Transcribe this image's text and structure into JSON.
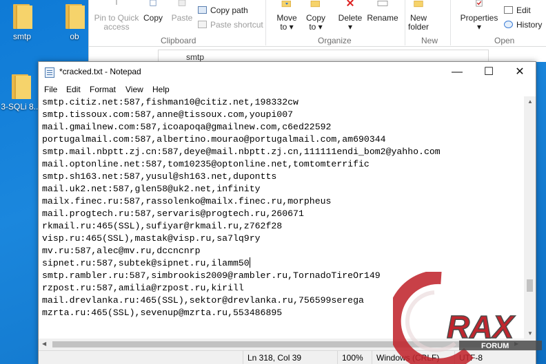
{
  "desktop": {
    "icons": [
      {
        "label": "smtp"
      },
      {
        "label": "ob"
      },
      {
        "label": "3-SQLi 8..."
      }
    ]
  },
  "explorer": {
    "ribbon": {
      "pin": "Pin to Quick\naccess",
      "copy": "Copy",
      "paste": "Paste",
      "copy_path": "Copy path",
      "paste_shortcut": "Paste shortcut",
      "clipboard": "Clipboard",
      "move_to": "Move\nto ▾",
      "copy_to": "Copy\nto ▾",
      "delete": "Delete\n▾",
      "rename": "Rename",
      "organize": "Organize",
      "new_folder": "New\nfolder",
      "new": "New",
      "properties": "Properties\n▾",
      "edit": "Edit",
      "history": "History",
      "open": "Open"
    },
    "address": "smtp"
  },
  "notepad": {
    "title": "*cracked.txt - Notepad",
    "window_buttons": {
      "minimize": "—",
      "maximize": "☐",
      "close": "✕"
    },
    "menu": [
      "File",
      "Edit",
      "Format",
      "View",
      "Help"
    ],
    "lines": [
      "smtp.citiz.net:587,fishman10@citiz.net,198332cw",
      "smtp.tissoux.com:587,anne@tissoux.com,youpi007",
      "mail.gmailnew.com:587,icoapoqa@gmailnew.com,c6ed22592",
      "portugalmail.com:587,albertino.mourao@portugalmail.com,am690344",
      "smtp.mail.nbptt.zj.cn:587,deye@mail.nbptt.zj.cn,111111endi_bom2@yahho.com",
      "mail.optonline.net:587,tom10235@optonline.net,tomtomterrific",
      "smtp.sh163.net:587,yusul@sh163.net,dupontts",
      "mail.uk2.net:587,glen58@uk2.net,infinity",
      "mailx.finec.ru:587,rassolenko@mailx.finec.ru,morpheus",
      "mail.progtech.ru:587,servaris@progtech.ru,260671",
      "rkmail.ru:465(SSL),sufiyar@rkmail.ru,z762f28",
      "visp.ru:465(SSL),mastak@visp.ru,sa7lq9ry",
      "mv.ru:587,alec@mv.ru,dccncnrp",
      "sipnet.ru:587,subtek@sipnet.ru,ilamm50",
      "smtp.rambler.ru:587,simbrookis2009@rambler.ru,TornadoTireOr149",
      "rzpost.ru:587,amilia@rzpost.ru,kirill",
      "mail.drevlanka.ru:465(SSL),sektor@drevlanka.ru,756599serega",
      "mzrta.ru:465(SSL),sevenup@mzrta.ru,553486895"
    ],
    "status": {
      "position": "Ln 318, Col 39",
      "zoom": "100%",
      "line_endings": "Windows (CRLF)",
      "encoding": "UTF-8"
    }
  },
  "watermark": {
    "text": "RAX",
    "subtext": "FORUM",
    "color": "#c0262e"
  }
}
